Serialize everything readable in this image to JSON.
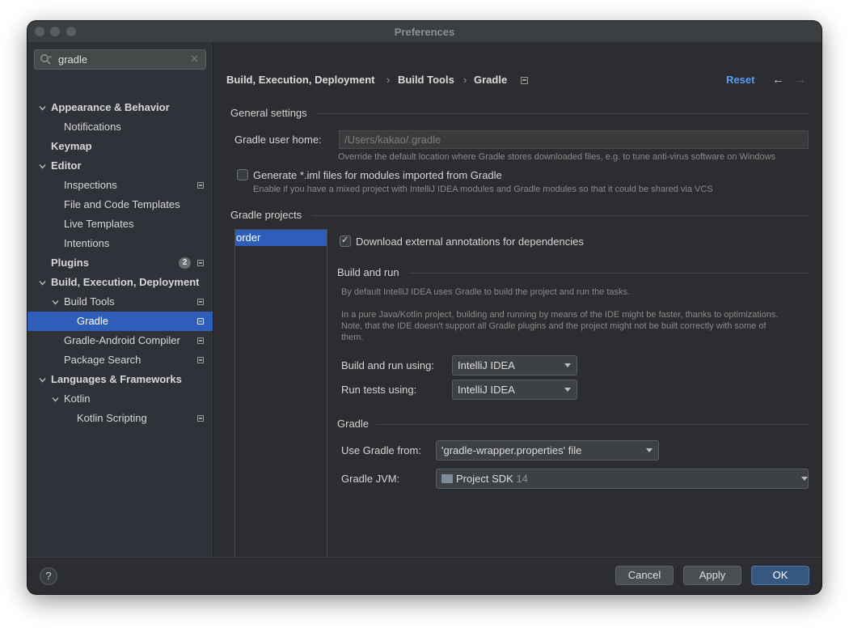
{
  "window": {
    "title": "Preferences"
  },
  "search": {
    "value": "gradle",
    "icon": "search-icon"
  },
  "sidebar": {
    "items": [
      {
        "label": "Appearance & Behavior",
        "level": 0,
        "bold": true,
        "expanded": true
      },
      {
        "label": "Notifications",
        "level": 1
      },
      {
        "label": "Keymap",
        "level": 0,
        "bold": true
      },
      {
        "label": "Editor",
        "level": 0,
        "bold": true,
        "expanded": true
      },
      {
        "label": "Inspections",
        "level": 1,
        "project_icon": true
      },
      {
        "label": "File and Code Templates",
        "level": 1
      },
      {
        "label": "Live Templates",
        "level": 1
      },
      {
        "label": "Intentions",
        "level": 1
      },
      {
        "label": "Plugins",
        "level": 0,
        "bold": true,
        "badge": "2",
        "project_icon": true
      },
      {
        "label": "Build, Execution, Deployment",
        "level": 0,
        "bold": true,
        "expanded": true
      },
      {
        "label": "Build Tools",
        "level": 1,
        "expanded": true,
        "project_icon": true
      },
      {
        "label": "Gradle",
        "level": 2,
        "selected": true,
        "project_icon": true
      },
      {
        "label": "Gradle-Android Compiler",
        "level": 1,
        "project_icon": true
      },
      {
        "label": "Package Search",
        "level": 1,
        "project_icon": true
      },
      {
        "label": "Languages & Frameworks",
        "level": 0,
        "bold": true,
        "expanded": true
      },
      {
        "label": "Kotlin",
        "level": 1,
        "expanded": true
      },
      {
        "label": "Kotlin Scripting",
        "level": 2,
        "project_icon": true
      }
    ]
  },
  "breadcrumb": {
    "items": [
      "Build, Execution, Deployment",
      "Build Tools",
      "Gradle"
    ],
    "separator": "›",
    "reset_label": "Reset",
    "back_icon": "←",
    "forward_icon": "→"
  },
  "general": {
    "title": "General settings",
    "user_home_label": "Gradle user home:",
    "user_home_value": "/Users/kakao/.gradle",
    "user_home_hint": "Override the default location where Gradle stores downloaded files, e.g. to tune anti-virus software on Windows",
    "iml_label": "Generate *.iml files for modules imported from Gradle",
    "iml_checked": false,
    "iml_hint": "Enable if you have a mixed project with IntelliJ IDEA modules and Gradle modules so that it could be shared via VCS"
  },
  "projects": {
    "title": "Gradle projects",
    "list": [
      "order"
    ],
    "download_annotations_label": "Download external annotations for dependencies",
    "download_annotations_checked": true,
    "build_run": {
      "title": "Build and run",
      "desc1": "By default IntelliJ IDEA uses Gradle to build the project and run the tasks.",
      "desc2_line1": "In a pure Java/Kotlin project, building and running by means of the IDE might be faster, thanks to optimizations.",
      "desc2_line2": "Note, that the IDE doesn't support all Gradle plugins and the project might not be built correctly with some of",
      "desc2_line3": "them.",
      "build_using_label": "Build and run using:",
      "build_using_value": "IntelliJ IDEA",
      "tests_using_label": "Run tests using:",
      "tests_using_value": "IntelliJ IDEA"
    },
    "gradle": {
      "title": "Gradle",
      "use_from_label": "Use Gradle from:",
      "use_from_value": "'gradle-wrapper.properties' file",
      "jvm_label": "Gradle JVM:",
      "jvm_value": "Project SDK",
      "jvm_version": "14"
    }
  },
  "footer": {
    "help_label": "?",
    "cancel_label": "Cancel",
    "apply_label": "Apply",
    "ok_label": "OK"
  },
  "colors": {
    "accent": "#2e5dba",
    "link": "#589df6",
    "ok_button": "#365880",
    "background": "#2b2d30",
    "sidebar": "#2f3239"
  }
}
